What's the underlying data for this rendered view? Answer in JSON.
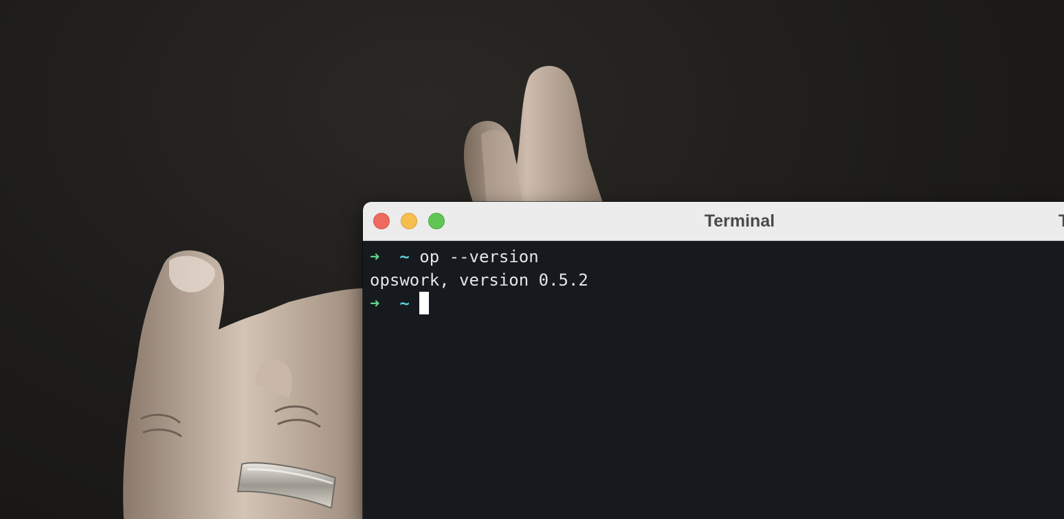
{
  "window": {
    "title": "Terminal",
    "title_partial_right": "T"
  },
  "terminal": {
    "lines": [
      {
        "prompt_arrow": "➜",
        "prompt_dir": "~",
        "command": "op --version"
      },
      {
        "output": "opswork, version 0.5.2"
      },
      {
        "prompt_arrow": "➜",
        "prompt_dir": "~",
        "command": ""
      }
    ]
  },
  "colors": {
    "prompt_arrow": "#5fd68a",
    "prompt_dir": "#5ad0d6",
    "terminal_bg": "#16191e",
    "titlebar_bg": "#ececec",
    "close": "#ee6a5f",
    "minimize": "#f5be4f",
    "zoom": "#61c554"
  },
  "icons": {
    "close": "close-traffic-light",
    "minimize": "minimize-traffic-light",
    "zoom": "zoom-traffic-light"
  }
}
